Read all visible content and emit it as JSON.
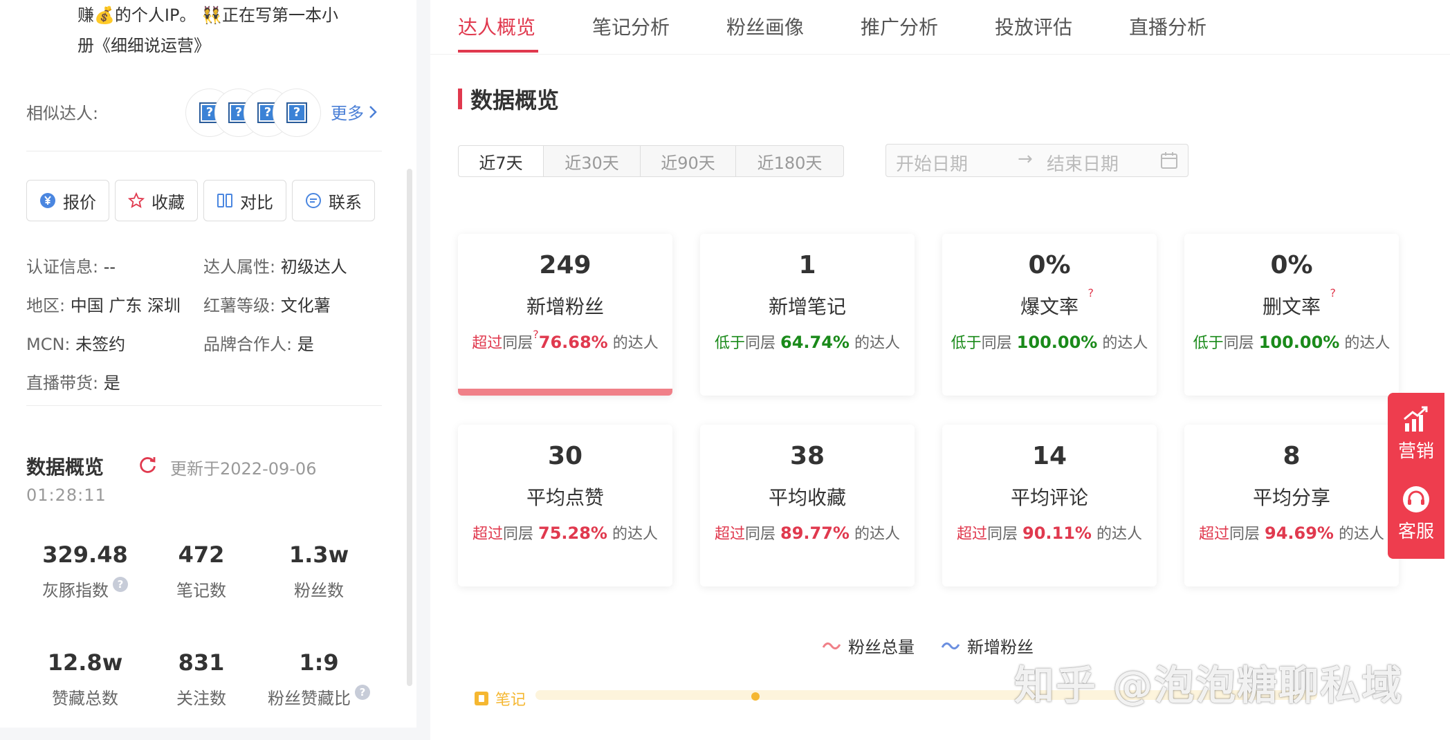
{
  "profile": {
    "bio_line1": "赚💰的个人IP。 👯正在写第一本小",
    "bio_line2": "册《细细说运营》",
    "similar_label": "相似达人:",
    "avatar_placeholder": "?",
    "more_label": "更多",
    "buttons": {
      "quote": "报价",
      "favorite": "收藏",
      "compare": "对比",
      "contact": "联系"
    },
    "info": {
      "cert_key": "认证信息:",
      "cert_val": "--",
      "attr_key": "达人属性:",
      "attr_val": "初级达人",
      "region_key": "地区:",
      "region_val": "中国 广东 深圳",
      "level_key": "红薯等级:",
      "level_val": "文化薯",
      "mcn_key": "MCN:",
      "mcn_val": "未签约",
      "brand_key": "品牌合作人:",
      "brand_val": "是",
      "live_key": "直播带货:",
      "live_val": "是"
    },
    "overview": {
      "title": "数据概览",
      "updated_prefix": "更新于2022-09-06",
      "updated_time": "01:28:11",
      "stats": [
        {
          "value": "329.48",
          "label": "灰豚指数",
          "help": true
        },
        {
          "value": "472",
          "label": "笔记数"
        },
        {
          "value": "1.3w",
          "label": "粉丝数"
        },
        {
          "value": "12.8w",
          "label": "赞藏总数"
        },
        {
          "value": "831",
          "label": "关注数"
        },
        {
          "value": "1:9",
          "label": "粉丝赞藏比",
          "help": true
        }
      ]
    }
  },
  "tabs": [
    "达人概览",
    "笔记分析",
    "粉丝画像",
    "推广分析",
    "投放评估",
    "直播分析"
  ],
  "section_title": "数据概览",
  "ranges": [
    "近7天",
    "近30天",
    "近90天",
    "近180天"
  ],
  "date_picker": {
    "start": "开始日期",
    "arrow": "→",
    "end": "结束日期"
  },
  "cards": [
    {
      "value": "249",
      "label": "新增粉丝",
      "dir": "超过",
      "dir_type": "up",
      "mid": "同层",
      "pct": "76.68%",
      "suffix": "的达人",
      "q": "?"
    },
    {
      "value": "1",
      "label": "新增笔记",
      "dir": "低于",
      "dir_type": "down",
      "mid": "同层",
      "pct": "64.74%",
      "suffix": "的达人"
    },
    {
      "value": "0%",
      "label": "爆文率",
      "dir": "低于",
      "dir_type": "down",
      "mid": "同层",
      "pct": "100.00%",
      "suffix": "的达人",
      "q": "?"
    },
    {
      "value": "0%",
      "label": "删文率",
      "dir": "低于",
      "dir_type": "down",
      "mid": "同层",
      "pct": "100.00%",
      "suffix": "的达人",
      "q": "?"
    },
    {
      "value": "30",
      "label": "平均点赞",
      "dir": "超过",
      "dir_type": "up",
      "mid": "同层",
      "pct": "75.28%",
      "suffix": "的达人"
    },
    {
      "value": "38",
      "label": "平均收藏",
      "dir": "超过",
      "dir_type": "up",
      "mid": "同层",
      "pct": "89.77%",
      "suffix": "的达人"
    },
    {
      "value": "14",
      "label": "平均评论",
      "dir": "超过",
      "dir_type": "up",
      "mid": "同层",
      "pct": "90.11%",
      "suffix": "的达人"
    },
    {
      "value": "8",
      "label": "平均分享",
      "dir": "超过",
      "dir_type": "up",
      "mid": "同层",
      "pct": "94.69%",
      "suffix": "的达人"
    }
  ],
  "legend": {
    "total": "粉丝总量",
    "new": "新增粉丝"
  },
  "timeline_label": "笔记",
  "watermark": "知乎 @泡泡糖聊私域",
  "float": {
    "marketing": "营销",
    "service": "客服"
  },
  "colors": {
    "accent": "#e0394e",
    "down": "#1a8a1a",
    "link": "#4a7fd6",
    "note": "#f5b731"
  }
}
